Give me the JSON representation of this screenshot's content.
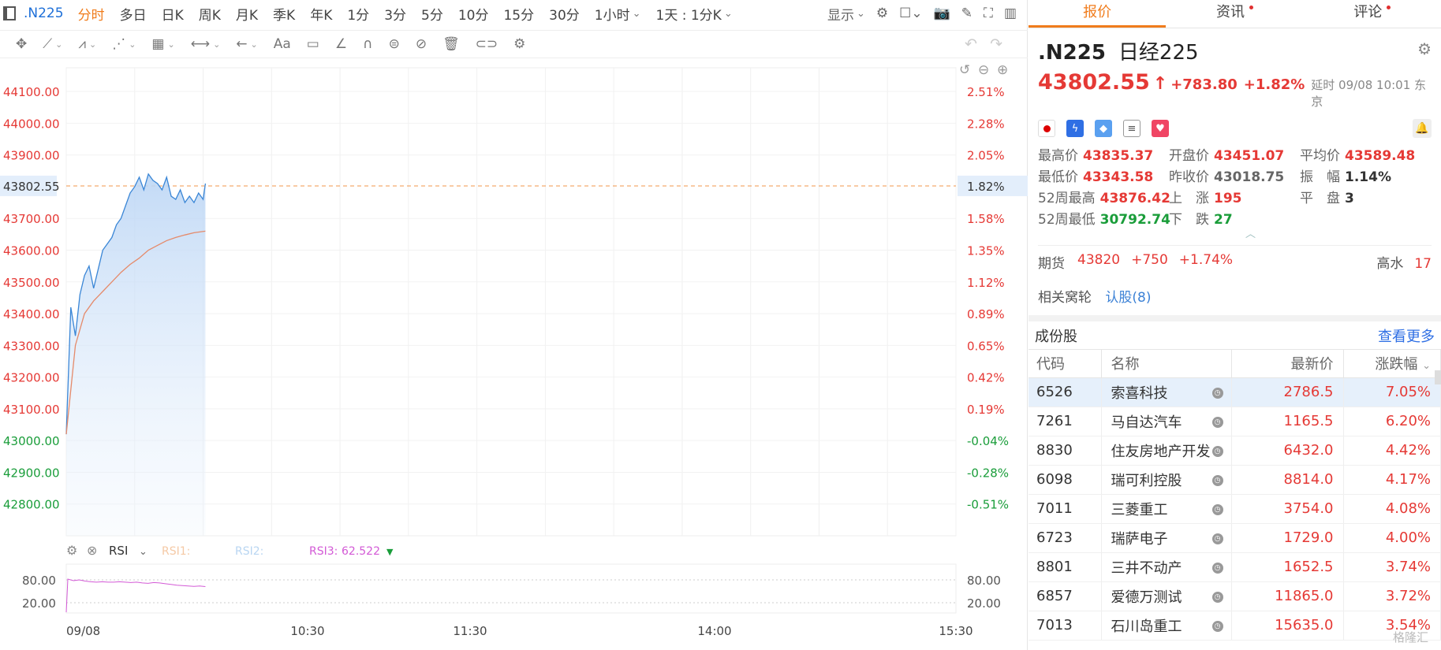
{
  "toolbar": {
    "symbol": ".N225",
    "periods": [
      "分时",
      "多日",
      "日K",
      "周K",
      "月K",
      "季K",
      "年K",
      "1分",
      "3分",
      "5分",
      "10分",
      "15分",
      "30分"
    ],
    "active_period": "分时",
    "hour_select": "1小时",
    "range_select": "1天 : 1分K",
    "display_label": "显示"
  },
  "draw_tools": {
    "text_tool": "Aa"
  },
  "chart": {
    "price_labels": [
      "44100.00",
      "44000.00",
      "43900.00",
      "43802.55",
      "43700.00",
      "43600.00",
      "43500.00",
      "43400.00",
      "43300.00",
      "43200.00",
      "43100.00",
      "43000.00",
      "42900.00",
      "42800.00"
    ],
    "pct_labels": [
      "2.51%",
      "2.28%",
      "2.05%",
      "1.82%",
      "1.58%",
      "1.35%",
      "1.12%",
      "0.89%",
      "0.65%",
      "0.42%",
      "0.19%",
      "-0.04%",
      "-0.28%",
      "-0.51%"
    ],
    "time_labels": [
      "09/08",
      "10:30",
      "11:30",
      "14:00",
      "15:30"
    ],
    "rsi_name": "RSI",
    "rsi1": "RSI1:",
    "rsi2": "RSI2:",
    "rsi3_label": "RSI3:",
    "rsi3_value": "62.522",
    "rsi_levels": [
      "80.00",
      "20.00"
    ],
    "colors": {
      "up": "#e53935",
      "down": "#1a9d3a",
      "price_line": "#3a86d6",
      "avg_line": "#e58a6a",
      "rsi3": "#d35ad6"
    }
  },
  "chart_data": {
    "type": "line",
    "xlabel": "",
    "ylabel": "",
    "ylim": [
      42700,
      44150
    ],
    "prev_close": 43018.75,
    "last_price": 43802.55,
    "series": [
      {
        "x": [
          "09:00",
          "09:02",
          "09:04",
          "09:06",
          "09:08",
          "09:10",
          "09:12",
          "09:14",
          "09:16",
          "09:18",
          "09:20",
          "09:22",
          "09:24",
          "09:26",
          "09:28",
          "09:30",
          "09:32",
          "09:34",
          "09:36",
          "09:38",
          "09:40",
          "09:42",
          "09:44",
          "09:46",
          "09:48",
          "09:50",
          "09:52",
          "09:54",
          "09:56",
          "09:58",
          "10:00",
          "10:01"
        ],
        "values": [
          43020,
          43420,
          43330,
          43460,
          43520,
          43550,
          43480,
          43540,
          43600,
          43620,
          43640,
          43680,
          43700,
          43740,
          43780,
          43800,
          43830,
          43790,
          43840,
          43820,
          43810,
          43790,
          43830,
          43770,
          43760,
          43790,
          43750,
          43770,
          43750,
          43780,
          43760,
          43810
        ]
      },
      {
        "x": [
          "09:00",
          "09:04",
          "09:08",
          "09:12",
          "09:16",
          "09:20",
          "09:24",
          "09:28",
          "09:32",
          "09:36",
          "09:40",
          "09:44",
          "09:48",
          "09:52",
          "09:56",
          "10:01"
        ],
        "values": [
          43020,
          43300,
          43400,
          43440,
          43470,
          43500,
          43530,
          43555,
          43575,
          43600,
          43615,
          43630,
          43640,
          43648,
          43655,
          43660
        ]
      }
    ],
    "rsi_series": {
      "levels": [
        80,
        20
      ],
      "values": [
        82,
        78,
        80,
        77,
        75,
        74,
        75,
        74,
        74,
        75,
        74,
        73,
        74,
        72,
        71,
        73,
        72,
        70,
        68,
        66,
        65,
        64,
        63,
        64,
        62.5
      ]
    }
  },
  "tabs": [
    {
      "label": "报价",
      "active": true,
      "dot": false
    },
    {
      "label": "资讯",
      "active": false,
      "dot": true
    },
    {
      "label": "评论",
      "active": false,
      "dot": true
    }
  ],
  "quote": {
    "code": ".N225",
    "name": "日经225",
    "price": "43802.55",
    "change": "+783.80",
    "change_pct": "+1.82%",
    "delay": "延时 09/08 10:01 东京",
    "stats": [
      [
        {
          "label": "最高价",
          "value": "43835.37",
          "color": "red"
        },
        {
          "label": "开盘价",
          "value": "43451.07",
          "color": "red"
        },
        {
          "label": "平均价",
          "value": "43589.48",
          "color": "red"
        }
      ],
      [
        {
          "label": "最低价",
          "value": "43343.58",
          "color": "red"
        },
        {
          "label": "昨收价",
          "value": "43018.75",
          "color": "gray"
        },
        {
          "label": "振　幅",
          "value": "1.14%",
          "color": "dark"
        }
      ],
      [
        {
          "label": "52周最高",
          "value": "43876.42",
          "color": "red"
        },
        {
          "label": "上　涨",
          "value": "195",
          "color": "red"
        },
        {
          "label": "平　盘",
          "value": "3",
          "color": "dark"
        }
      ],
      [
        {
          "label": "52周最低",
          "value": "30792.74",
          "color": "green"
        },
        {
          "label": "下　跌",
          "value": "27",
          "color": "green"
        }
      ]
    ],
    "futures_label": "期货",
    "futures_price": "43820",
    "futures_change": "+750",
    "futures_pct": "+1.74%",
    "high_water_label": "高水",
    "high_water_value": "17",
    "warrant_label": "相关窝轮",
    "warrant_link": "认股(8)"
  },
  "constituents": {
    "title": "成份股",
    "more": "查看更多",
    "columns": [
      "代码",
      "名称",
      "最新价",
      "涨跌幅"
    ],
    "rows": [
      {
        "code": "6526",
        "name": "索喜科技",
        "price": "2786.5",
        "pct": "7.05%"
      },
      {
        "code": "7261",
        "name": "马自达汽车",
        "price": "1165.5",
        "pct": "6.20%"
      },
      {
        "code": "8830",
        "name": "住友房地产开发",
        "price": "6432.0",
        "pct": "4.42%"
      },
      {
        "code": "6098",
        "name": "瑞可利控股",
        "price": "8814.0",
        "pct": "4.17%"
      },
      {
        "code": "7011",
        "name": "三菱重工",
        "price": "3754.0",
        "pct": "4.08%"
      },
      {
        "code": "6723",
        "name": "瑞萨电子",
        "price": "1729.0",
        "pct": "4.00%"
      },
      {
        "code": "8801",
        "name": "三井不动产",
        "price": "1652.5",
        "pct": "3.74%"
      },
      {
        "code": "6857",
        "name": "爱德万测试",
        "price": "11865.0",
        "pct": "3.72%"
      },
      {
        "code": "7013",
        "name": "石川岛重工",
        "price": "15635.0",
        "pct": "3.54%"
      }
    ]
  },
  "watermark": "格隆汇"
}
